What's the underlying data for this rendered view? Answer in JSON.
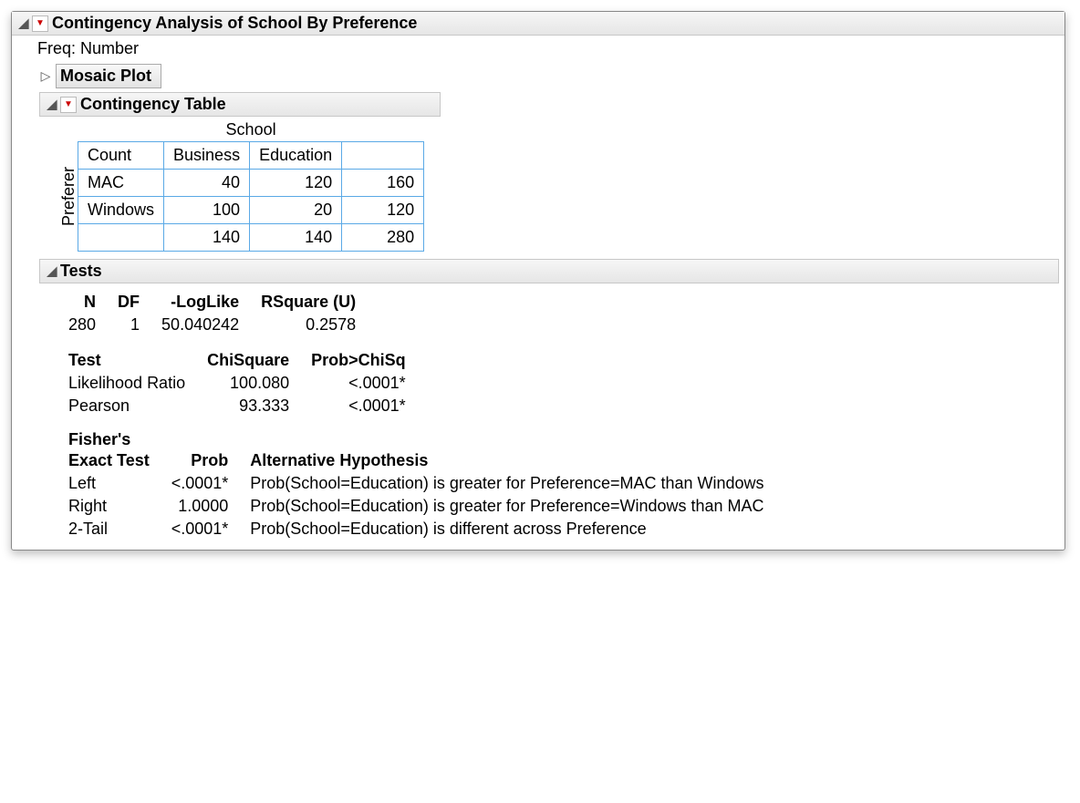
{
  "main": {
    "title": "Contingency Analysis of School By Preference",
    "freq_label": "Freq: Number",
    "mosaic_label": "Mosaic Plot"
  },
  "ct": {
    "title": "Contingency Table",
    "col_var": "School",
    "row_var": "Preferer",
    "count_label": "Count",
    "cols": [
      "Business",
      "Education"
    ],
    "rows": [
      "MAC",
      "Windows"
    ],
    "cells": [
      [
        40,
        120
      ],
      [
        100,
        20
      ]
    ],
    "row_totals": [
      160,
      120
    ],
    "col_totals": [
      140,
      140
    ],
    "grand_total": 280
  },
  "tests": {
    "title": "Tests",
    "headers": {
      "n": "N",
      "df": "DF",
      "loglike": "-LogLike",
      "rsq": "RSquare (U)"
    },
    "values": {
      "n": "280",
      "df": "1",
      "loglike": "50.040242",
      "rsq": "0.2578"
    },
    "t2_headers": {
      "test": "Test",
      "chisq": "ChiSquare",
      "prob": "Prob>ChiSq"
    },
    "t2_rows": [
      {
        "name": "Likelihood Ratio",
        "chisq": "100.080",
        "prob": "<.0001*"
      },
      {
        "name": "Pearson",
        "chisq": "93.333",
        "prob": "<.0001*"
      }
    ],
    "fisher_title1": "Fisher's",
    "fisher_headers": {
      "test": "Exact Test",
      "prob": "Prob",
      "alt": "Alternative Hypothesis"
    },
    "fisher_rows": [
      {
        "name": "Left",
        "prob": "<.0001*",
        "alt": "Prob(School=Education) is greater for Preference=MAC than Windows"
      },
      {
        "name": "Right",
        "prob": "1.0000",
        "alt": "Prob(School=Education) is greater for Preference=Windows than MAC"
      },
      {
        "name": "2-Tail",
        "prob": "<.0001*",
        "alt": "Prob(School=Education) is different across Preference"
      }
    ]
  }
}
